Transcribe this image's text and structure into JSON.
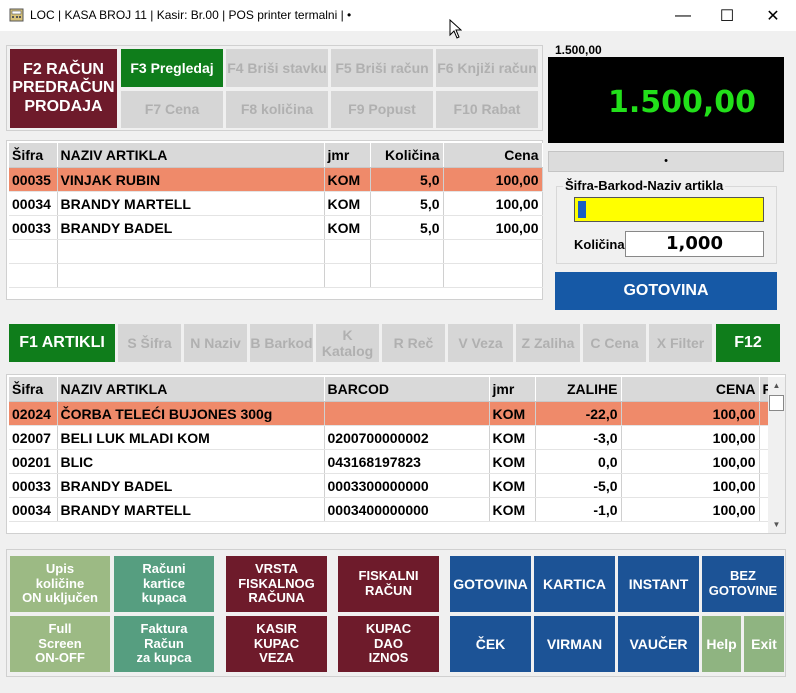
{
  "window": {
    "title": "LOC | KASA BROJ 11 | Kasir:  Br.00 | POS printer termalni | •",
    "minimize": "—",
    "maximize": "☐",
    "close": "✕"
  },
  "fkeys": {
    "f2": "F2 RAČUN\nPREDRAČUN\nPRODAJA",
    "f3": "F3 Pregledaj",
    "f4": "F4 Briši stavku",
    "f5": "F5 Briši račun",
    "f6": "F6 Knjiži račun",
    "f7": "F7 Cena",
    "f8": "F8 količina",
    "f9": "F9 Popust",
    "f10": "F10 Rabat"
  },
  "display": {
    "small_total": "1.500,00",
    "total": "1.500,00",
    "status_dot": "•"
  },
  "entry": {
    "legend": "Šifra-Barkod-Naziv artikla",
    "qty_label": "Količina",
    "qty_value": "1,000",
    "gotovina": "GOTOVINA"
  },
  "bill": {
    "headers": [
      "Šifra",
      "NAZIV ARTIKLA",
      "jmr",
      "Količina",
      "Cena"
    ],
    "rows": [
      [
        "00035",
        "VINJAK RUBIN",
        "KOM",
        "5,0",
        "100,00"
      ],
      [
        "00034",
        "BRANDY MARTELL",
        "KOM",
        "5,0",
        "100,00"
      ],
      [
        "00033",
        "BRANDY BADEL",
        "KOM",
        "5,0",
        "100,00"
      ]
    ]
  },
  "search": {
    "f1": "F1 ARTIKLI",
    "f12": "F12",
    "filters": [
      "S Šifra",
      "N Naziv",
      "B Barkod",
      "K Katalog",
      "R Reč",
      "V Veza",
      "Z Zaliha",
      "C Cena",
      "X Filter"
    ]
  },
  "articles": {
    "headers": [
      "Šifra",
      "NAZIV ARTIKLA",
      "BARCOD",
      "jmr",
      "ZALIHE",
      "CENA",
      "F"
    ],
    "rows": [
      [
        "02024",
        "ČORBA TELEĆI BUJONES 300g",
        "",
        "KOM",
        "-22,0",
        "100,00"
      ],
      [
        "02007",
        "BELI LUK MLADI KOM",
        "0200700000002",
        "KOM",
        "-3,0",
        "100,00"
      ],
      [
        "00201",
        "BLIC",
        "043168197823",
        "KOM",
        "0,0",
        "100,00"
      ],
      [
        "00033",
        "BRANDY BADEL",
        "0003300000000",
        "KOM",
        "-5,0",
        "100,00"
      ],
      [
        "00034",
        "BRANDY MARTELL",
        "0003400000000",
        "KOM",
        "-1,0",
        "100,00"
      ]
    ]
  },
  "bottom": {
    "upis": "Upis\nkoličine\nON uključen",
    "racuni": "Računi\nkartice\nkupaca",
    "vrsta": "VRSTA\nFISKALNOG\nRAČUNA",
    "fiskalni": "FISKALNI\nRAČUN",
    "gotovina": "GOTOVINA",
    "kartica": "KARTICA",
    "instant": "INSTANT",
    "bez": "BEZ\nGOTOVINE",
    "full": "Full\nScreen\nON-OFF",
    "faktura": "Faktura\nRačun\nza kupca",
    "kasir": "KASIR\nKUPAC\nVEZA",
    "kupac": "KUPAC\nDAO\nIZNOS",
    "cek": "ČEK",
    "virman": "VIRMAN",
    "vaucer": "VAUČER",
    "help": "Help",
    "exit": "Exit"
  },
  "colors": {
    "selected_row": "#ef8a6a",
    "total_text": "#22e01a",
    "maroon": "#6e1b2b",
    "green": "#0f7d1b",
    "blue": "#1659a6",
    "input_yellow": "#ffff00"
  }
}
